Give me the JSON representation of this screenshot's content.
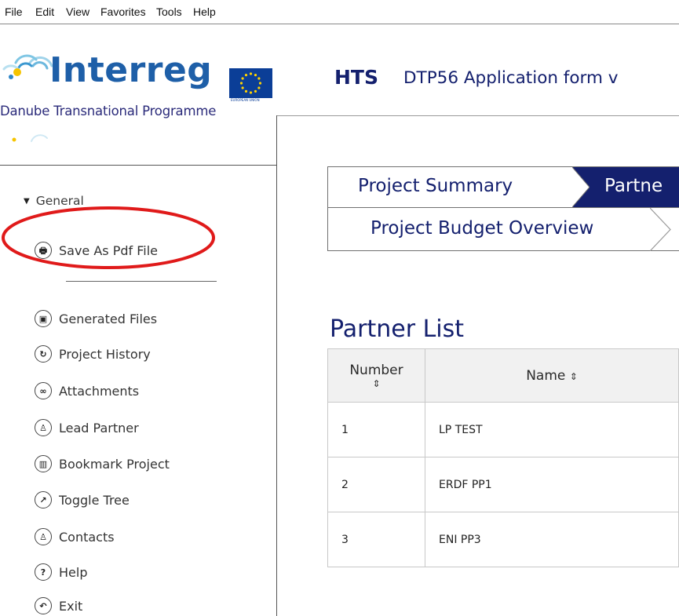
{
  "menubar": {
    "items": [
      "File",
      "Edit",
      "View",
      "Favorites",
      "Tools",
      "Help"
    ]
  },
  "header": {
    "logo_title": "Interreg",
    "logo_subtitle": "Danube Transnational Programme",
    "eu_caption": "EUROPEAN UNION",
    "app_short": "HTS",
    "app_title": "DTP56 Application form v"
  },
  "sidebar": {
    "group_label": "General",
    "group_expanded": true,
    "highlight_color": "#e01a1a",
    "items": [
      {
        "label": "Save As Pdf File",
        "icon": "printer-icon",
        "glyph": "🖶"
      },
      {
        "label": "Generated Files",
        "icon": "save-icon",
        "glyph": "▣"
      },
      {
        "label": "Project History",
        "icon": "history-icon",
        "glyph": "↻"
      },
      {
        "label": "Attachments",
        "icon": "link-icon",
        "glyph": "∞"
      },
      {
        "label": "Lead Partner",
        "icon": "user-icon",
        "glyph": "♙"
      },
      {
        "label": "Bookmark Project",
        "icon": "bookmark-icon",
        "glyph": "▥"
      },
      {
        "label": "Toggle Tree",
        "icon": "external-link-icon",
        "glyph": "↗"
      },
      {
        "label": "Contacts",
        "icon": "contacts-icon",
        "glyph": "♙"
      },
      {
        "label": "Help",
        "icon": "help-icon",
        "glyph": "?"
      },
      {
        "label": "Exit",
        "icon": "exit-icon",
        "glyph": "↶"
      }
    ]
  },
  "tabs": {
    "row1": [
      "Project Summary",
      "Partne"
    ],
    "row2": [
      "Project Budget Overview"
    ],
    "active": "Partne",
    "active_color": "#14206e"
  },
  "partner_list": {
    "title": "Partner List",
    "columns": [
      {
        "label": "Number",
        "sort_icon": "⇕"
      },
      {
        "label": "Name",
        "sort_icon": "⇕"
      }
    ],
    "rows": [
      {
        "number": "1",
        "name": "LP TEST"
      },
      {
        "number": "2",
        "name": "ERDF PP1"
      },
      {
        "number": "3",
        "name": "ENI PP3"
      }
    ]
  },
  "colors": {
    "brand_blue": "#1e5fa8",
    "navy": "#14206e",
    "eu_blue": "#0b3e97",
    "eu_star": "#ffd200"
  }
}
